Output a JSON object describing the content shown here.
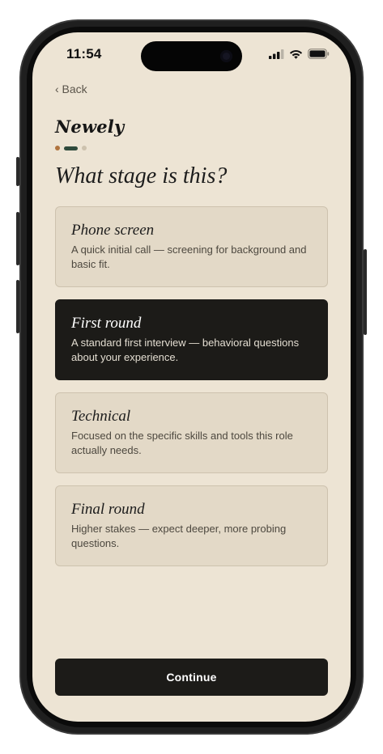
{
  "status_bar": {
    "time": "11:54",
    "icons": [
      "cellular-signal-icon",
      "wifi-icon",
      "battery-icon"
    ]
  },
  "nav": {
    "back_label": "‹ Back"
  },
  "brand": {
    "name": "Newely"
  },
  "progress": {
    "step": 2,
    "total": 3,
    "colors": {
      "done": "#b0743f",
      "current": "#2f4a3c",
      "upcoming": "#cdc2ae"
    }
  },
  "question": "What stage is this?",
  "options": [
    {
      "title": "Phone screen",
      "description": "A quick initial call — screening for background and basic fit.",
      "selected": false
    },
    {
      "title": "First round",
      "description": "A standard first interview — behavioral questions about your experience.",
      "selected": true
    },
    {
      "title": "Technical",
      "description": "Focused on the specific skills and tools this role actually needs.",
      "selected": false
    },
    {
      "title": "Final round",
      "description": "Higher stakes — expect deeper, more probing questions.",
      "selected": false
    }
  ],
  "continue_label": "Continue",
  "colors": {
    "background": "#ede4d4",
    "card": "#e3d9c7",
    "card_border": "#cdc2ae",
    "selected_card": "#1c1b18",
    "primary_button": "#1c1b18"
  }
}
